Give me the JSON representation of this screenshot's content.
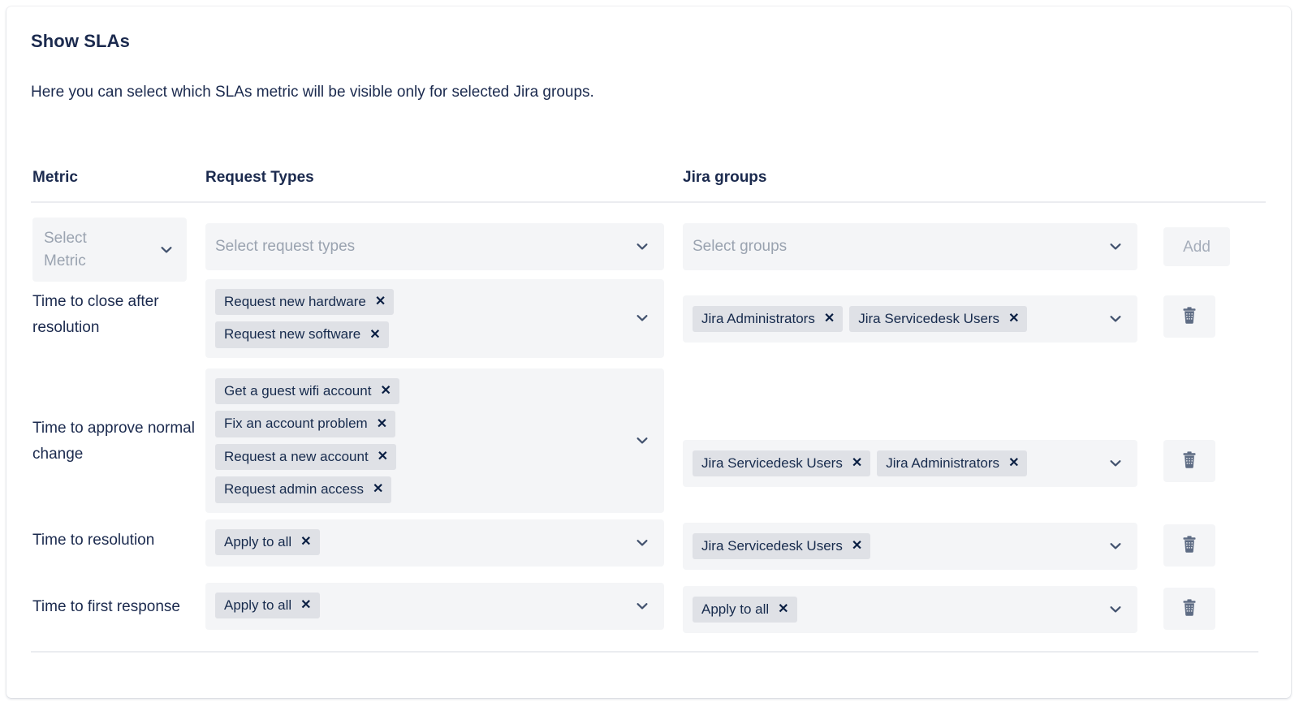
{
  "card": {
    "title": "Show SLAs",
    "description": "Here you can select which SLAs metric will be visible only for selected Jira groups."
  },
  "table": {
    "headers": {
      "metric": "Metric",
      "request_types": "Request Types",
      "jira_groups": "Jira groups"
    },
    "new_row": {
      "metric_placeholder": "Select\nMetric",
      "metric_placeholder_line1": "Select",
      "metric_placeholder_line2": "Metric",
      "request_types_placeholder": "Select request types",
      "groups_placeholder": "Select groups",
      "add_label": "Add"
    },
    "rows": [
      {
        "metric": "Time to close after resolution",
        "request_types": [
          "Request new hardware",
          "Request new software"
        ],
        "jira_groups": [
          "Jira Administrators",
          "Jira Servicedesk Users"
        ],
        "groups_layout": "inline"
      },
      {
        "metric": "Time to approve normal change",
        "request_types": [
          "Get a guest wifi account",
          "Fix an account problem",
          "Request a new account",
          "Request admin access"
        ],
        "jira_groups": [
          "Jira Servicedesk Users",
          "Jira Administrators"
        ],
        "groups_layout": "inline"
      },
      {
        "metric": "Time to resolution",
        "request_types": [
          "Apply to all"
        ],
        "jira_groups": [
          "Jira Servicedesk Users"
        ],
        "groups_layout": "inline"
      },
      {
        "metric": "Time to first response",
        "request_types": [
          "Apply to all"
        ],
        "jira_groups": [
          "Apply to all"
        ],
        "groups_layout": "inline"
      }
    ]
  },
  "icons": {
    "chevron": "chevron-down-icon",
    "trash": "trash-icon",
    "chip_remove": "✕"
  },
  "colors": {
    "text_navy": "#1b2a4e",
    "field_bg": "#f4f5f7",
    "chip_bg": "#dfe1e6",
    "placeholder": "#9aa3b0",
    "divider": "#ebecf0"
  }
}
